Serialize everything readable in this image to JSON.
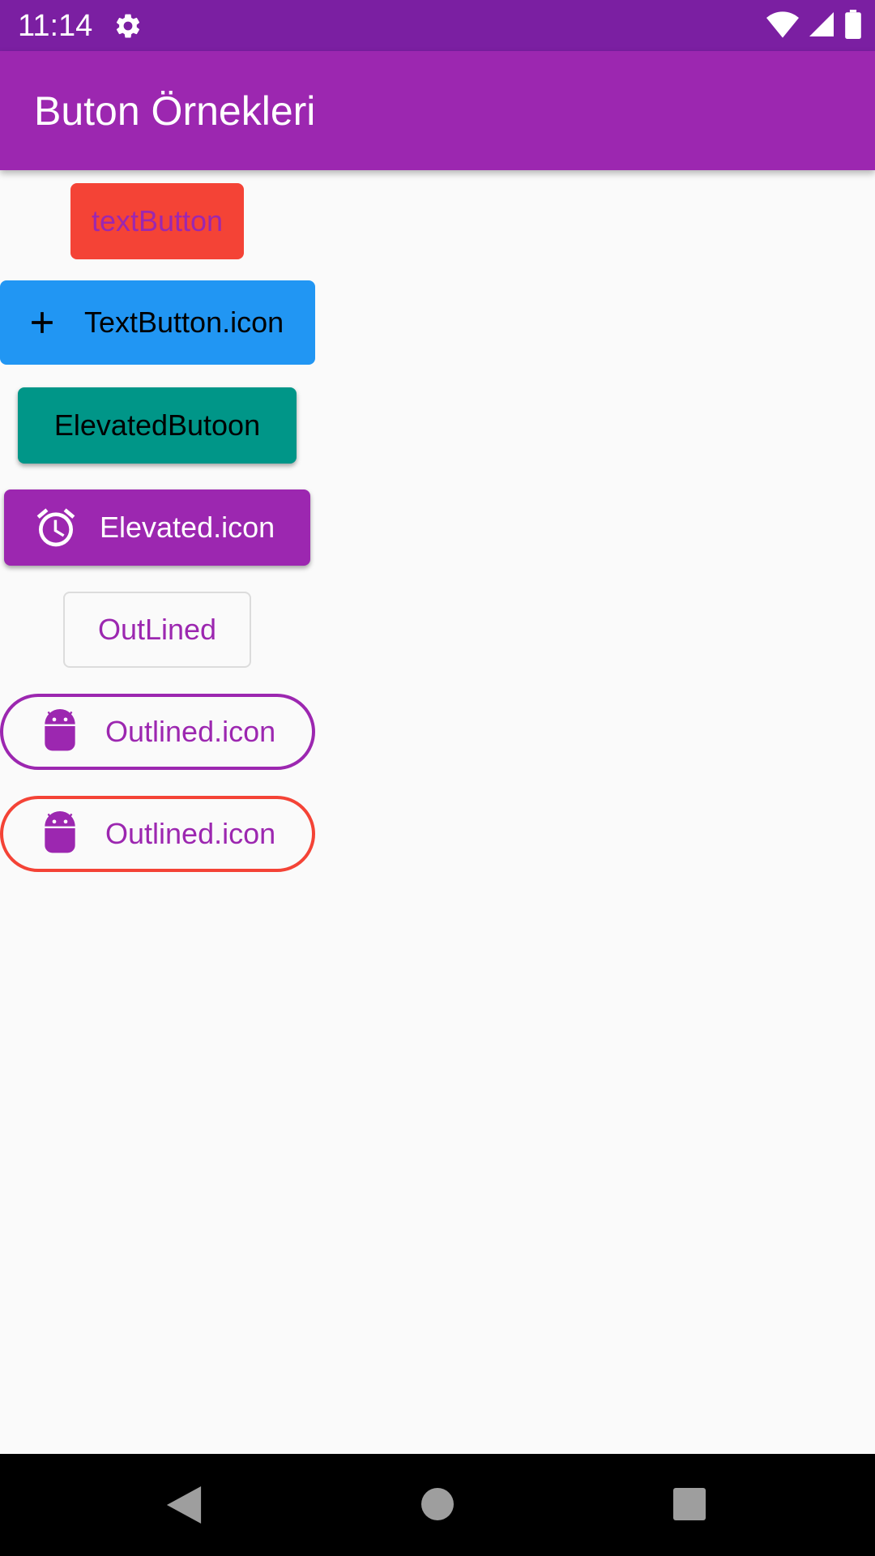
{
  "status_bar": {
    "time": "11:14",
    "icons": [
      "gear-icon",
      "wifi-icon",
      "signal-icon",
      "battery-icon"
    ]
  },
  "app_bar": {
    "title": "Buton Örnekleri",
    "color": "#9c27b0"
  },
  "buttons": {
    "text_button": {
      "label": "textButton",
      "background": "#f44336",
      "text_color": "#9c27b0"
    },
    "text_button_icon": {
      "label": "TextButton.icon",
      "icon": "add-icon",
      "background": "#2196f3"
    },
    "elevated_button": {
      "label": "ElevatedButoon",
      "background": "#009688"
    },
    "elevated_icon": {
      "label": "Elevated.icon",
      "icon": "alarm-icon",
      "background": "#9c27b0"
    },
    "outlined": {
      "label": "OutLined",
      "text_color": "#9c27b0"
    },
    "outlined_icon": {
      "label": "Outlined.icon",
      "icon": "android-icon",
      "border_color": "#9c27b0"
    },
    "outlined_icon_red": {
      "label": "Outlined.icon",
      "icon": "android-icon",
      "border_color": "#f44336"
    }
  },
  "nav_bar": {
    "icons": [
      "back-icon",
      "home-icon",
      "recents-icon"
    ]
  }
}
